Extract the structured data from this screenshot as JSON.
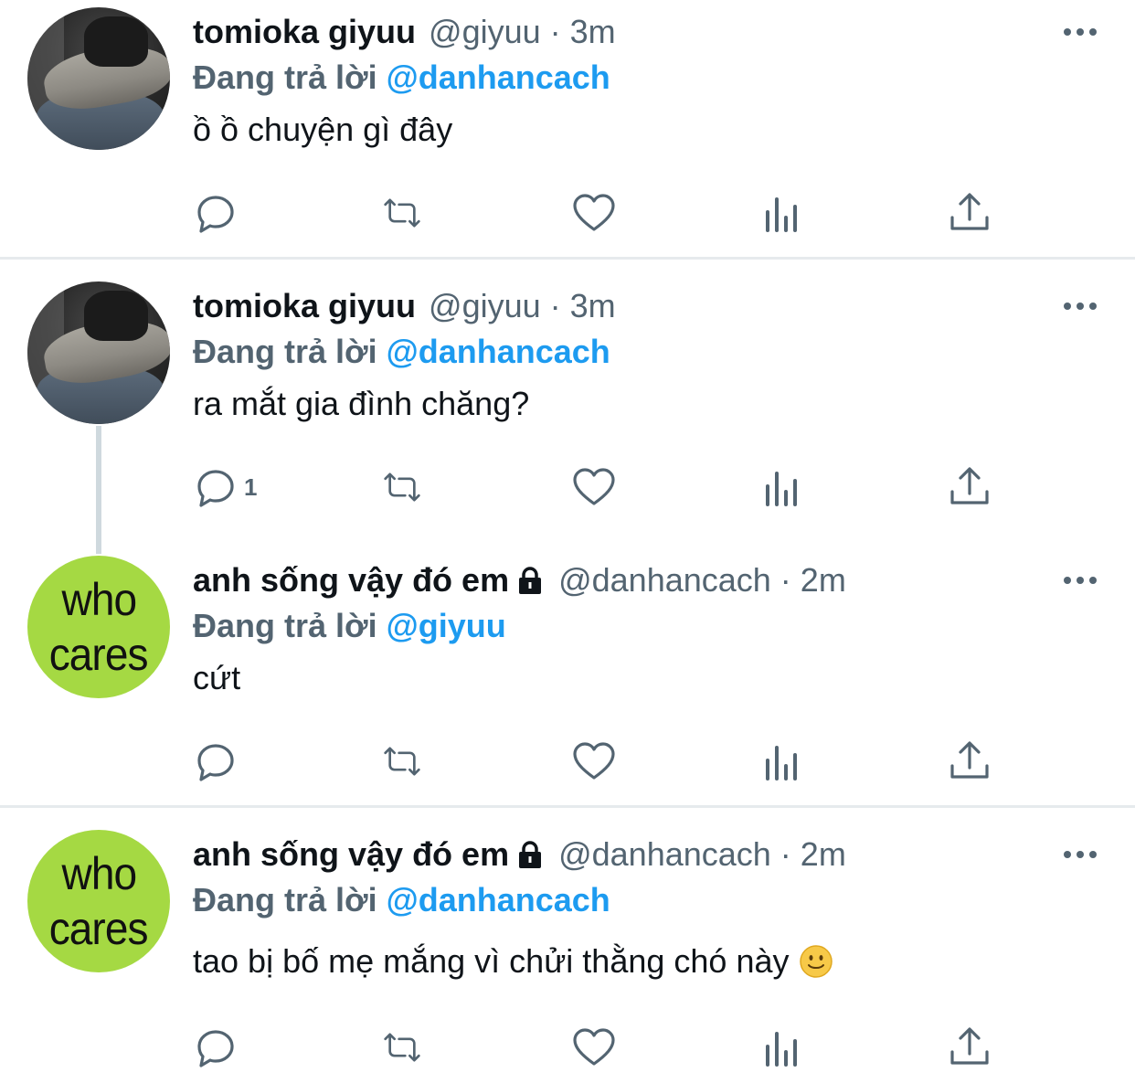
{
  "tweets": [
    {
      "name": "tomioka giyuu",
      "handle": "@giyuu",
      "sep": "·",
      "time": "3m",
      "replying_label": "Đang trả lời",
      "replying_to": "@danhancach",
      "text": "ồ ồ chuyện gì đây",
      "reply_count": ""
    },
    {
      "name": "tomioka giyuu",
      "handle": "@giyuu",
      "sep": "·",
      "time": "3m",
      "replying_label": "Đang trả lời",
      "replying_to": "@danhancach",
      "text": "ra mắt gia đình chăng?",
      "reply_count": "1"
    },
    {
      "name": "anh sống vậy đó em",
      "handle": "@danhancach",
      "sep": "·",
      "time": "2m",
      "replying_label": "Đang trả lời",
      "replying_to": "@giyuu",
      "text": "cứt",
      "reply_count": "",
      "avatar_text": [
        "who",
        "cares"
      ]
    },
    {
      "name": "anh sống vậy đó em",
      "handle": "@danhancach",
      "sep": "·",
      "time": "2m",
      "replying_label": "Đang trả lời",
      "replying_to": "@danhancach",
      "text": "tao bị bố mẹ mắng vì chửi thằng chó này",
      "reply_count": "",
      "avatar_text": [
        "who",
        "cares"
      ],
      "emoji": "slightly-smiling-face"
    }
  ],
  "colors": {
    "accent": "#1d9bf0",
    "secondary_text": "#536471",
    "icon": "#536471",
    "divider": "#e6eaed",
    "avatar_green": "#a5d943"
  },
  "icons": [
    "reply-icon",
    "retweet-icon",
    "like-icon",
    "views-icon",
    "share-icon",
    "more-icon",
    "lock-icon"
  ]
}
